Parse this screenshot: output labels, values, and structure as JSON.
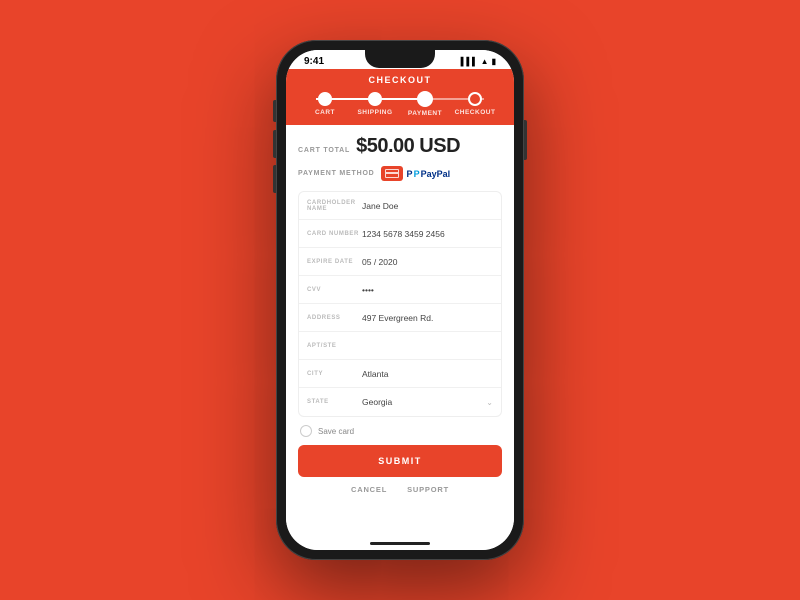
{
  "status_bar": {
    "time": "9:41",
    "icons": "▌▌▌ ▲ 🔋"
  },
  "header": {
    "title": "CHECKOUT",
    "steps": [
      {
        "id": "cart",
        "label": "CART",
        "state": "completed"
      },
      {
        "id": "shipping",
        "label": "SHIPPING",
        "state": "completed"
      },
      {
        "id": "payment",
        "label": "PAYMENT",
        "state": "active"
      },
      {
        "id": "checkout",
        "label": "CHECKOUT",
        "state": "inactive"
      }
    ]
  },
  "cart": {
    "label": "CART TOTAL",
    "amount": "$50.00 USD"
  },
  "payment_method": {
    "label": "PAYMENT METHOD",
    "paypal_text": "PayPal"
  },
  "form": {
    "fields": [
      {
        "label": "CARDHOLDER NAME",
        "value": "Jane Doe",
        "type": "text"
      },
      {
        "label": "CARD NUMBER",
        "value": "1234 5678 3459 2456",
        "type": "text"
      },
      {
        "label": "EXPIRE DATE",
        "value": "05  /  2020",
        "type": "text"
      },
      {
        "label": "CVV",
        "value": "••••",
        "type": "password"
      },
      {
        "label": "ADDRESS",
        "value": "497 Evergreen Rd.",
        "type": "text"
      },
      {
        "label": "APT/STE",
        "value": "",
        "type": "text"
      },
      {
        "label": "CITY",
        "value": "Atlanta",
        "type": "text"
      },
      {
        "label": "STATE",
        "value": "Georgia",
        "type": "select",
        "has_chevron": true
      }
    ]
  },
  "save_card": {
    "label": "Save card"
  },
  "buttons": {
    "submit": "SUBMIT",
    "cancel": "CANCEL",
    "support": "SUPPORT"
  },
  "colors": {
    "brand": "#E8442A",
    "white": "#ffffff"
  }
}
